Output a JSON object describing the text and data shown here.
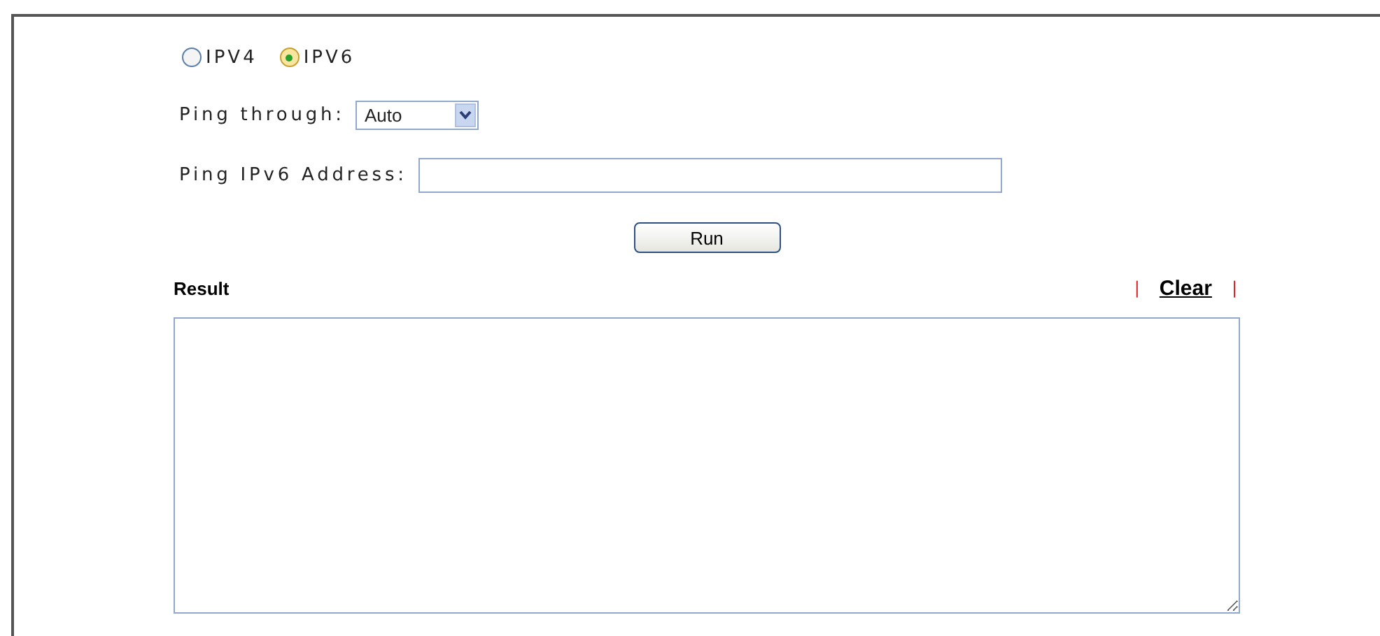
{
  "ip_version": [
    {
      "label": "IPV4",
      "selected": false
    },
    {
      "label": "IPV6",
      "selected": true
    }
  ],
  "ping_through": {
    "label": "Ping through:",
    "value": "Auto"
  },
  "address": {
    "label": "Ping IPv6 Address:"
  },
  "run_button": "Run",
  "result": {
    "title": "Result",
    "separator": "|",
    "clear_link": "Clear"
  }
}
